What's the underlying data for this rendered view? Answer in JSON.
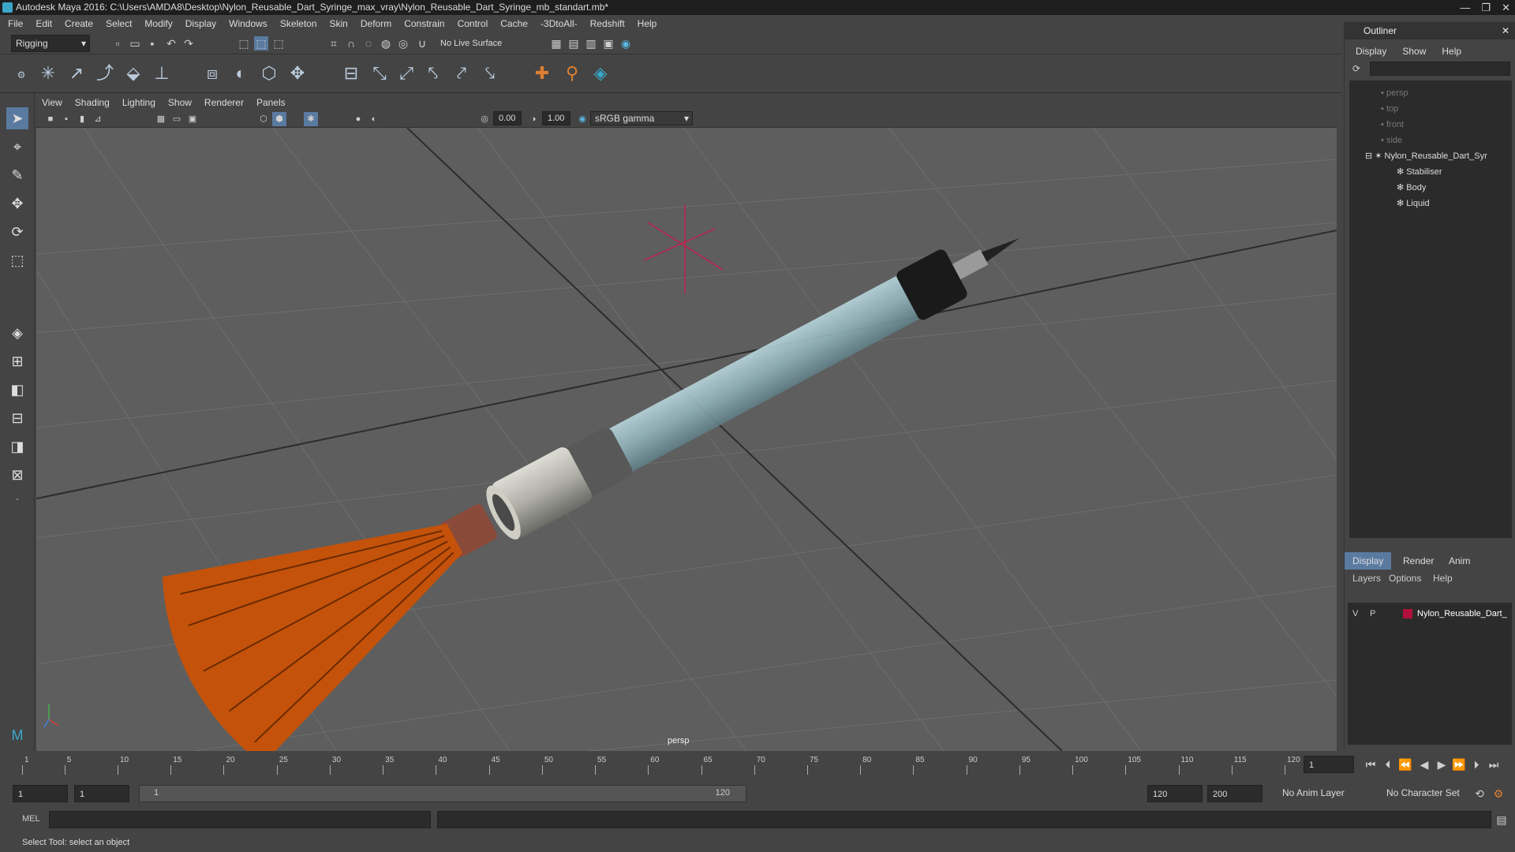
{
  "window": {
    "title": "Autodesk Maya 2016: C:\\Users\\AMDA8\\Desktop\\Nylon_Reusable_Dart_Syringe_max_vray\\Nylon_Reusable_Dart_Syringe_mb_standart.mb*",
    "controls": [
      "—",
      "❐",
      "✕"
    ]
  },
  "menubar": [
    "File",
    "Edit",
    "Create",
    "Select",
    "Modify",
    "Display",
    "Windows",
    "Skeleton",
    "Skin",
    "Deform",
    "Constrain",
    "Control",
    "Cache",
    "-3DtoAll-",
    "Redshift",
    "Help"
  ],
  "status_line": {
    "menu_set": "Rigging",
    "live_surface": "No Live Surface"
  },
  "panel": {
    "menus": [
      "View",
      "Shading",
      "Lighting",
      "Show",
      "Renderer",
      "Panels"
    ],
    "exposure": "0.00",
    "gamma": "1.00",
    "color_space": "sRGB gamma",
    "camera_label": "persp"
  },
  "outliner": {
    "title": "Outliner",
    "menus": [
      "Display",
      "Show",
      "Help"
    ],
    "cameras": [
      "persp",
      "top",
      "front",
      "side"
    ],
    "root": "Nylon_Reusable_Dart_Syr",
    "children": [
      "Stabiliser",
      "Body",
      "Liquid"
    ]
  },
  "layer_editor": {
    "tabs": [
      "Display",
      "Render",
      "Anim"
    ],
    "menus": [
      "Layers",
      "Options",
      "Help"
    ],
    "layer": {
      "v": "V",
      "p": "P",
      "name": "Nylon_Reusable_Dart_",
      "color": "#b0103a"
    }
  },
  "time_slider": {
    "ticks": [
      "1",
      "5",
      "10",
      "15",
      "20",
      "25",
      "30",
      "35",
      "40",
      "45",
      "50",
      "55",
      "60",
      "65",
      "70",
      "75",
      "80",
      "85",
      "90",
      "95",
      "100",
      "105",
      "110",
      "115",
      "120"
    ],
    "current_frame": "1"
  },
  "range_slider": {
    "start": "1",
    "playback_start": "1",
    "slider_start": "1",
    "slider_end": "120",
    "playback_end": "120",
    "end": "200",
    "anim_layer": "No Anim Layer",
    "character_set": "No Character Set"
  },
  "command_line": {
    "label": "MEL"
  },
  "help_line": "Select Tool: select an object"
}
